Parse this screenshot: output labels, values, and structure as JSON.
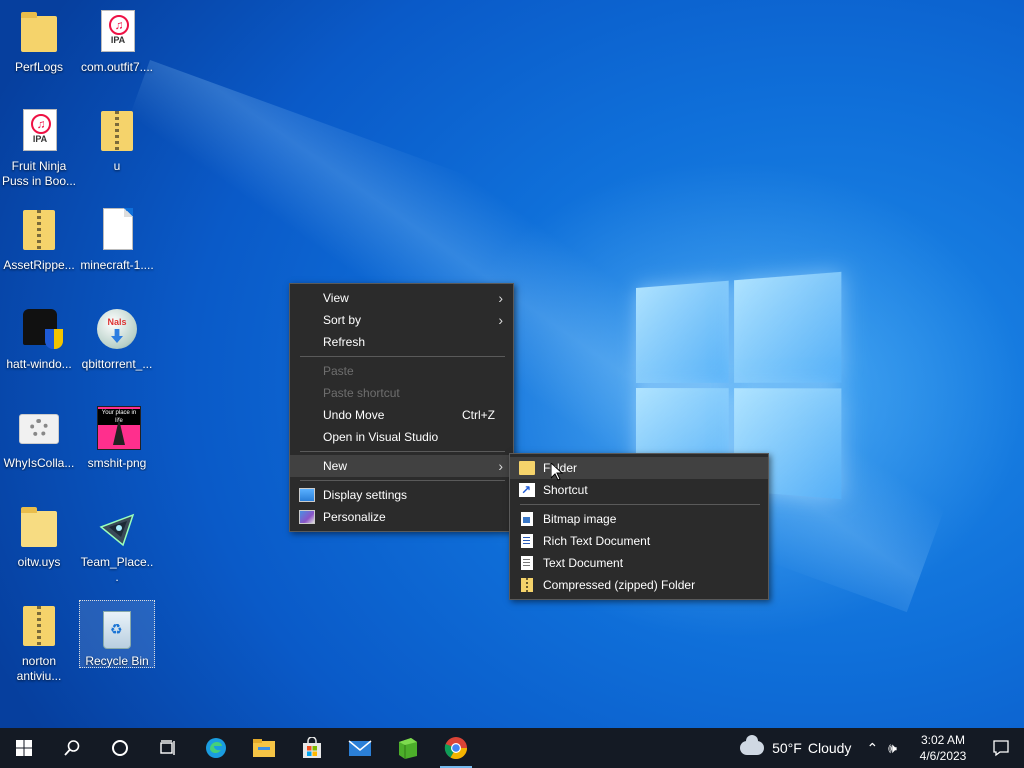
{
  "desktop_icons": [
    {
      "label": "PerfLogs",
      "icon": "folder-icon"
    },
    {
      "label": "com.outfit7....",
      "icon": "ipa-file-icon",
      "tag": "IPA"
    },
    {
      "label": "Fruit Ninja Puss in Boo...",
      "icon": "ipa-file-icon",
      "tag": "IPA"
    },
    {
      "label": "u",
      "icon": "zip-folder-icon"
    },
    {
      "label": "AssetRippe...",
      "icon": "zip-folder-icon"
    },
    {
      "label": "minecraft-1....",
      "icon": "blank-file-icon"
    },
    {
      "label": "hatt-windo...",
      "icon": "hat-shield-icon"
    },
    {
      "label": "qbittorrent_...",
      "icon": "qbittorrent-installer-icon",
      "tag": "Nals"
    },
    {
      "label": "WhyIsColla...",
      "icon": "gear-file-icon"
    },
    {
      "label": "smshit-png",
      "icon": "png-image-icon",
      "tag": "Your place in life"
    },
    {
      "label": "oitw.uys",
      "icon": "file-icon"
    },
    {
      "label": "Team_Place...",
      "icon": "ufo-app-icon"
    },
    {
      "label": "norton antiviu...",
      "icon": "zip-folder-icon"
    },
    {
      "label": "Recycle Bin",
      "icon": "recycle-bin-icon"
    }
  ],
  "context_menu": {
    "view": "View",
    "sort_by": "Sort by",
    "refresh": "Refresh",
    "paste": "Paste",
    "paste_shortcut": "Paste shortcut",
    "undo_move": "Undo Move",
    "undo_shortcut": "Ctrl+Z",
    "open_vs": "Open in Visual Studio",
    "new": "New",
    "display_settings": "Display settings",
    "personalize": "Personalize"
  },
  "new_submenu": {
    "folder": "Folder",
    "shortcut": "Shortcut",
    "bitmap": "Bitmap image",
    "rtf": "Rich Text Document",
    "text": "Text Document",
    "zip": "Compressed (zipped) Folder"
  },
  "taskbar": {
    "weather_temp": "50°F",
    "weather_desc": "Cloudy",
    "time": "3:02 AM",
    "date": "4/6/2023"
  },
  "colors": {
    "menu_bg": "#2b2b2b",
    "menu_hover": "#414141",
    "taskbar_bg": "#141a24",
    "accent": "#0f6fd9"
  }
}
